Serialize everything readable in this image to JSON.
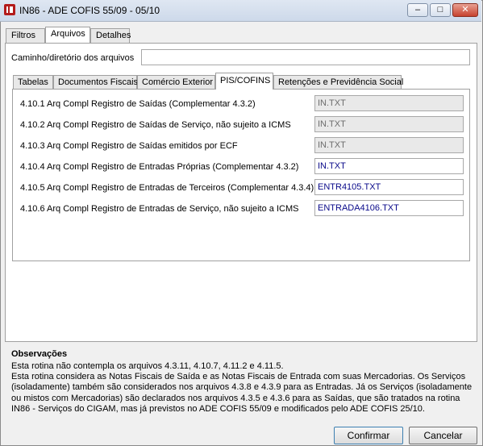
{
  "window": {
    "title": "IN86 - ADE COFIS 55/09 - 05/10",
    "controls": {
      "minimize": "–",
      "maximize": "□",
      "close": "✕"
    }
  },
  "top_tabs": [
    "Filtros",
    "Arquivos",
    "Detalhes"
  ],
  "path": {
    "label": "Caminho/diretório dos arquivos",
    "value": ""
  },
  "sub_tabs": [
    "Tabelas",
    "Documentos Fiscais",
    "Comércio Exterior",
    "PIS/COFINS",
    "Retenções e Previdência Social"
  ],
  "rows": [
    {
      "label": "4.10.1 Arq Compl Registro de Saídas (Complementar 4.3.2)",
      "value": "IN.TXT",
      "state": "disabled"
    },
    {
      "label": "4.10.2 Arq Compl Registro de Saídas de Serviço, não sujeito a ICMS",
      "value": "IN.TXT",
      "state": "disabled"
    },
    {
      "label": "4.10.3 Arq Compl Registro de Saídas emitidos por ECF",
      "value": "IN.TXT",
      "state": "disabled"
    },
    {
      "label": "4.10.4 Arq Compl Registro de Entradas Próprias (Complementar 4.3.2)",
      "value": "IN.TXT",
      "state": "enabled"
    },
    {
      "label": "4.10.5 Arq Compl Registro de Entradas de Terceiros (Complementar 4.3.4)",
      "value": "ENTR4105.TXT",
      "state": "enabled"
    },
    {
      "label": "4.10.6 Arq Compl Registro de Entradas de Serviço, não sujeito a ICMS",
      "value": "ENTRADA4106.TXT",
      "state": "enabled"
    }
  ],
  "observations": {
    "title": "Observações",
    "lines": [
      "Esta rotina não contempla os arquivos 4.3.11, 4.10.7, 4.11.2 e 4.11.5.",
      "Esta rotina considera as Notas Fiscais de Saída e as Notas Fiscais de Entrada com suas Mercadorias. Os Serviços",
      "(isoladamente) também são considerados nos arquivos 4.3.8 e 4.3.9 para as Entradas. Já os Serviços (isoladamente",
      "ou mistos com Mercadorias) são declarados nos arquivos 4.3.5 e 4.3.6 para as Saídas, que são tratados na rotina",
      "IN86 - Serviços do CIGAM, mas já previstos no ADE COFIS 55/09 e modificados pelo ADE COFIS 25/10."
    ]
  },
  "buttons": {
    "confirm": "Confirmar",
    "cancel": "Cancelar"
  }
}
